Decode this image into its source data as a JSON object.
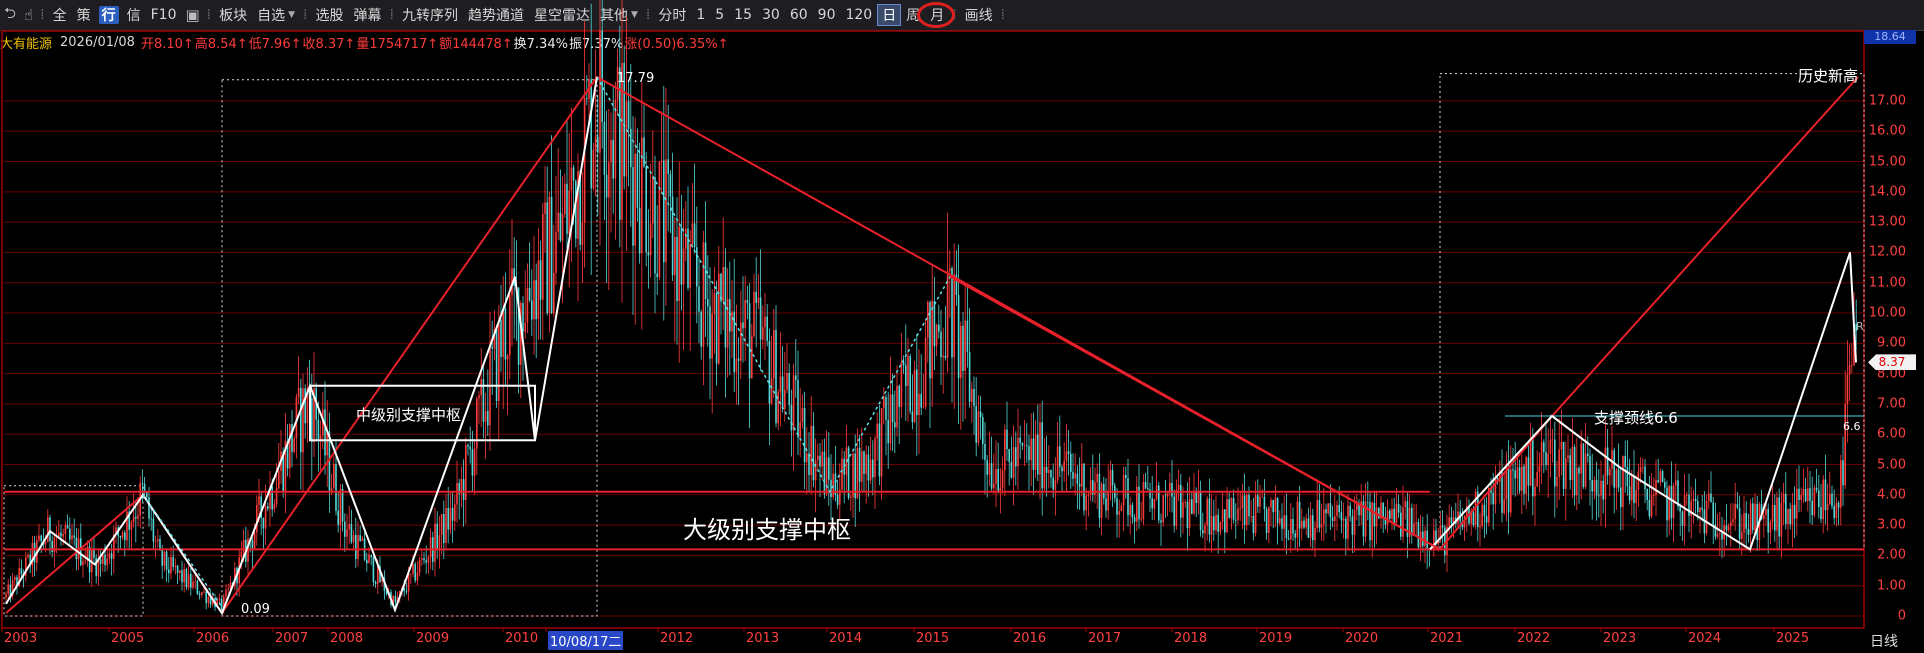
{
  "toolbar": {
    "items": [
      {
        "type": "icon",
        "name": "back-icon",
        "glyph": "⮌"
      },
      {
        "type": "icon",
        "name": "hand-icon",
        "glyph": "☝"
      },
      {
        "type": "sep"
      },
      {
        "type": "text",
        "name": "tb-all",
        "label": "全"
      },
      {
        "type": "text",
        "name": "tb-ce",
        "label": "策"
      },
      {
        "type": "hl",
        "name": "tb-hang",
        "label": "行"
      },
      {
        "type": "text",
        "name": "tb-xin",
        "label": "信"
      },
      {
        "type": "text",
        "name": "tb-f10",
        "label": "F10"
      },
      {
        "type": "icon",
        "name": "layers-icon",
        "glyph": "▣"
      },
      {
        "type": "sep"
      },
      {
        "type": "text",
        "name": "tb-bankuai",
        "label": "板块"
      },
      {
        "type": "drop",
        "name": "tb-zixuan",
        "label": "自选"
      },
      {
        "type": "sep"
      },
      {
        "type": "text",
        "name": "tb-xuangu",
        "label": "选股"
      },
      {
        "type": "text",
        "name": "tb-danmu",
        "label": "弹幕"
      },
      {
        "type": "sep"
      },
      {
        "type": "text",
        "name": "tb-jiuzhuan",
        "label": "九转序列"
      },
      {
        "type": "text",
        "name": "tb-qushi",
        "label": "趋势通道"
      },
      {
        "type": "text",
        "name": "tb-xingkong",
        "label": "星空雷达"
      },
      {
        "type": "drop",
        "name": "tb-qita",
        "label": "其他"
      },
      {
        "type": "sep"
      },
      {
        "type": "text",
        "name": "tb-fenshi",
        "label": "分时"
      },
      {
        "type": "text",
        "name": "tb-1",
        "label": "1"
      },
      {
        "type": "text",
        "name": "tb-5",
        "label": "5"
      },
      {
        "type": "text",
        "name": "tb-15",
        "label": "15"
      },
      {
        "type": "text",
        "name": "tb-30",
        "label": "30"
      },
      {
        "type": "text",
        "name": "tb-60",
        "label": "60"
      },
      {
        "type": "text",
        "name": "tb-90",
        "label": "90"
      },
      {
        "type": "text",
        "name": "tb-120",
        "label": "120"
      },
      {
        "type": "active",
        "name": "tb-ri",
        "label": "日"
      },
      {
        "type": "text",
        "name": "tb-zhou",
        "label": "周"
      },
      {
        "type": "text",
        "name": "tb-yue",
        "label": "月"
      },
      {
        "type": "sep"
      },
      {
        "type": "text",
        "name": "tb-huaxian",
        "label": "画线"
      },
      {
        "type": "sep"
      }
    ]
  },
  "info": {
    "name": "大有能源",
    "date": "2026/01/08",
    "open": "开8.10↑",
    "high": "高8.54↑",
    "low": "低7.96↑",
    "close": "收8.37↑",
    "volume": "量1754717↑",
    "amount": "额144478↑",
    "turnover": "换7.34%",
    "amplitude": "振7.37%",
    "change": "涨(0.50)6.35%↑"
  },
  "yaxis": {
    "labels": [
      "0",
      "1.00",
      "2.00",
      "3.00",
      "4.00",
      "5.00",
      "6.00",
      "7.00",
      "8.00",
      "9.00",
      "10.00",
      "11.00",
      "12.00",
      "13.00",
      "14.00",
      "15.00",
      "16.00",
      "17.00"
    ],
    "top_value": "18.64",
    "current_price": "8.37"
  },
  "xaxis": {
    "labels": [
      "2003",
      "2005",
      "2006",
      "2007",
      "2008",
      "2009",
      "2010",
      "10/08/17二",
      "2012",
      "2013",
      "2014",
      "2015",
      "2016",
      "2017",
      "2018",
      "2019",
      "2020",
      "2021",
      "2022",
      "2023",
      "2024",
      "2025"
    ],
    "selected": "10/08/17二",
    "period": "日线"
  },
  "annotations": {
    "high_label": "17.79",
    "low_label": "0.09",
    "history_high": "历史新高",
    "mid_zone": "中级别支撑中枢",
    "big_zone": "大级别支撑中枢",
    "neckline": "支撑颈线6.6",
    "neck_value": "6.6",
    "r_marker": "R"
  },
  "colors": {
    "candle_up": "#ff3c3c",
    "candle_down": "#54d8d8",
    "trendline": "#e8202a",
    "wave": "#ffffff",
    "grid": "#6a0000",
    "axis_text": "#ff4040"
  },
  "chart_data": {
    "type": "candlestick",
    "title": "大有能源",
    "ylim": [
      0,
      18.64
    ],
    "key_points": [
      {
        "x": "2003",
        "y": 0.2
      },
      {
        "x": "2004",
        "y": 2.8
      },
      {
        "x": "2005",
        "y": 4.0
      },
      {
        "x": "2006",
        "y": 0.09
      },
      {
        "x": "2007",
        "y": 7.6
      },
      {
        "x": "2008",
        "y": 0.2
      },
      {
        "x": "2010",
        "y": 11.2
      },
      {
        "x": "10/08/17",
        "y": 17.79
      },
      {
        "x": "2014",
        "y": 4.1
      },
      {
        "x": "2015",
        "y": 11.2
      },
      {
        "x": "2021",
        "y": 2.2
      },
      {
        "x": "2022",
        "y": 6.6
      },
      {
        "x": "2024",
        "y": 2.2
      },
      {
        "x": "2025",
        "y": 12.0
      },
      {
        "x": "2026/01/08",
        "y": 8.37
      }
    ],
    "horizontal_levels": [
      2.2,
      4.1,
      5.8,
      7.6,
      6.6
    ]
  }
}
